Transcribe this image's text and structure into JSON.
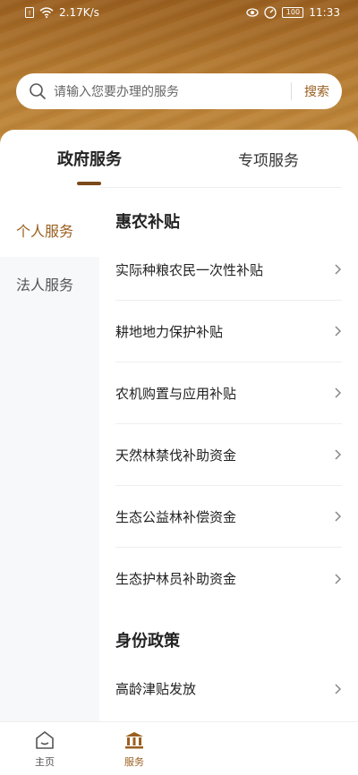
{
  "status_bar": {
    "network_speed": "2.17K/s",
    "battery": "100",
    "time": "11:33"
  },
  "search": {
    "placeholder": "请输入您要办理的服务",
    "button_label": "搜索"
  },
  "tabs": [
    {
      "label": "政府服务",
      "active": true
    },
    {
      "label": "专项服务",
      "active": false
    }
  ],
  "sidebar": {
    "items": [
      {
        "label": "个人服务",
        "active": true
      },
      {
        "label": "法人服务",
        "active": false
      }
    ]
  },
  "sections": [
    {
      "title": "惠农补贴",
      "items": [
        "实际种粮农民一次性补贴",
        "耕地地力保护补贴",
        "农机购置与应用补贴",
        "天然林禁伐补助资金",
        "生态公益林补偿资金",
        "生态护林员补助资金"
      ]
    },
    {
      "title": "身份政策",
      "items": [
        "高龄津贴发放"
      ]
    }
  ],
  "bottom_nav": [
    {
      "label": "主页",
      "icon": "home-icon",
      "active": false
    },
    {
      "label": "服务",
      "icon": "government-building-icon",
      "active": true
    }
  ],
  "colors": {
    "brand": "#9a5f1f",
    "header_gradient_top": "#9a5f1f",
    "header_gradient_bottom": "#c48c3e"
  }
}
